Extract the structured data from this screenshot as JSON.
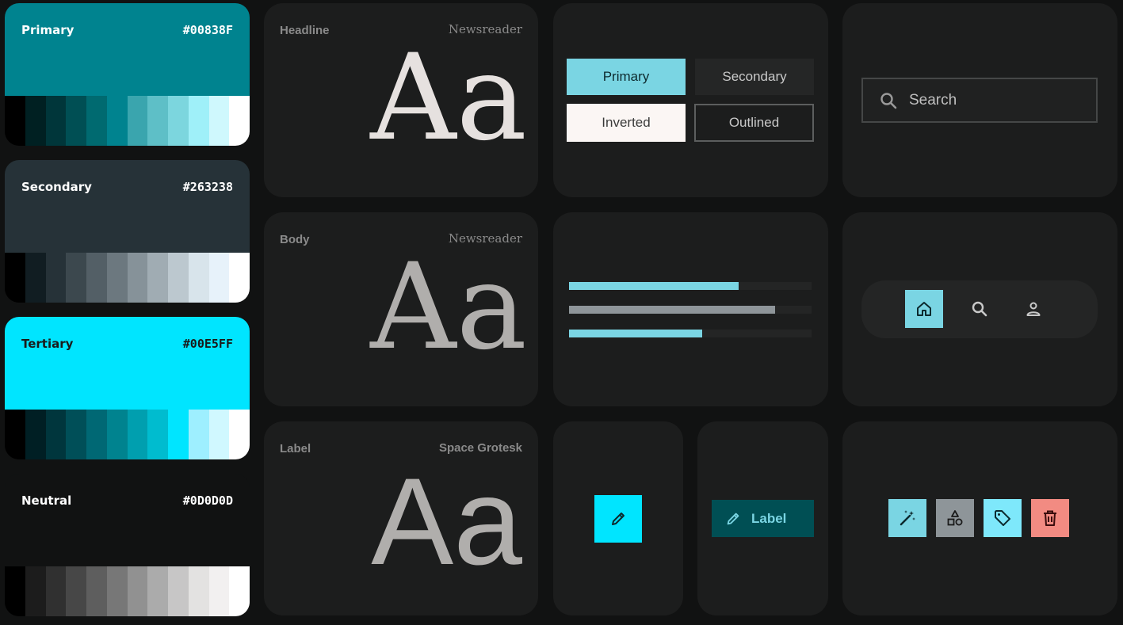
{
  "palette": [
    {
      "name": "Primary",
      "hex": "#00838F",
      "header_color": "#00838F",
      "text_color": "#ffffff",
      "tones": [
        "#000000",
        "#002022",
        "#00363a",
        "#004f54",
        "#006a70",
        "#00838f",
        "#3aa5ae",
        "#5ebfc7",
        "#7cd6de",
        "#9ff0f9",
        "#cff8fd",
        "#ffffff"
      ]
    },
    {
      "name": "Secondary",
      "hex": "#263238",
      "header_color": "#263238",
      "text_color": "#ffffff",
      "tones": [
        "#000000",
        "#111d22",
        "#263238",
        "#3c484e",
        "#535f66",
        "#6c787f",
        "#869299",
        "#a0acb3",
        "#bcc8cf",
        "#d8e4eb",
        "#e7f2fa",
        "#ffffff"
      ]
    },
    {
      "name": "Tertiary",
      "hex": "#00E5FF",
      "header_color": "#00E5FF",
      "text_color": "#1a1a1a",
      "tones": [
        "#000000",
        "#001f24",
        "#00363d",
        "#004f58",
        "#006874",
        "#00838f",
        "#009faf",
        "#00bccf",
        "#00e5ff",
        "#9eefff",
        "#d0f8ff",
        "#ffffff"
      ]
    },
    {
      "name": "Neutral",
      "hex": "#0D0D0D",
      "header_color": "#111212",
      "text_color": "#ffffff",
      "tones": [
        "#000000",
        "#1c1c1c",
        "#303030",
        "#474747",
        "#5e5e5e",
        "#777777",
        "#919191",
        "#ababab",
        "#c7c6c6",
        "#e3e2e1",
        "#f2f0f0",
        "#ffffff"
      ]
    }
  ],
  "typography": [
    {
      "role": "Headline",
      "font": "Newsreader",
      "sample": "Aa",
      "color": "#e6e1df"
    },
    {
      "role": "Body",
      "font": "Newsreader",
      "sample": "Aa",
      "color": "#b0aeac"
    },
    {
      "role": "Label",
      "font": "Space Grotesk",
      "sample": "Aa",
      "color": "#b0aeac"
    }
  ],
  "buttons": {
    "primary": "Primary",
    "secondary": "Secondary",
    "inverted": "Inverted",
    "outlined": "Outlined"
  },
  "search": {
    "placeholder": "Search",
    "icon": "search-icon"
  },
  "progress": [
    {
      "value": 0.7,
      "color": "#7ad5e3"
    },
    {
      "value": 0.85,
      "color": "#8e9599"
    },
    {
      "value": 0.55,
      "color": "#7ad5e3"
    }
  ],
  "nav": {
    "items": [
      {
        "icon": "home-icon",
        "active": true
      },
      {
        "icon": "search-icon",
        "active": false
      },
      {
        "icon": "person-icon",
        "active": false
      }
    ],
    "active_color": "#7ad5e3"
  },
  "fab": {
    "icon": "pencil-icon",
    "color": "#00e5ff"
  },
  "label_button": {
    "label": "Label",
    "icon": "pencil-icon",
    "color": "#004f54",
    "text_color": "#7ad5e3"
  },
  "icon_buttons": [
    {
      "icon": "magic-wand-icon",
      "color": "#7ad5e3"
    },
    {
      "icon": "shapes-icon",
      "color": "#8e9599"
    },
    {
      "icon": "tag-icon",
      "color": "#7ee8fb"
    },
    {
      "icon": "trash-icon",
      "color": "#f28b82"
    }
  ]
}
